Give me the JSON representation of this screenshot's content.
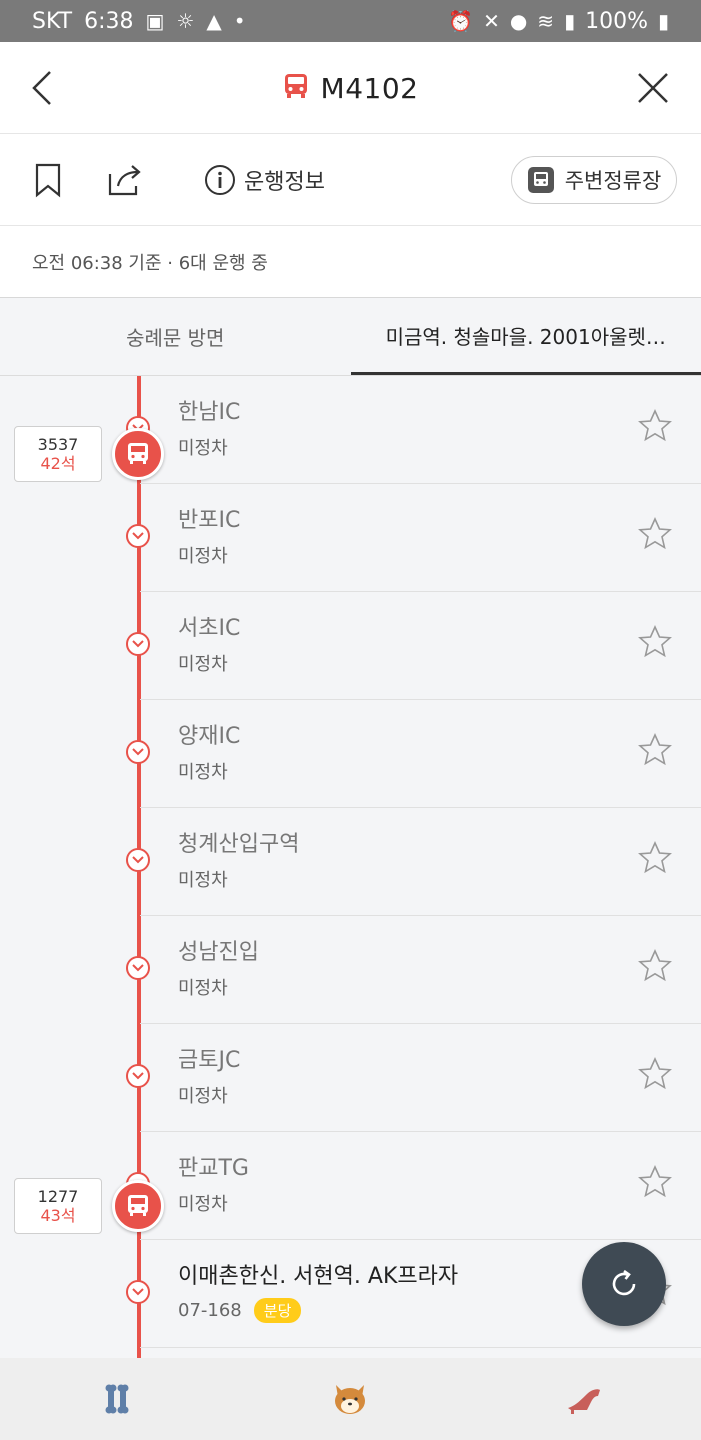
{
  "status_bar": {
    "carrier": "SKT",
    "time": "6:38",
    "battery": "100%"
  },
  "header": {
    "route_number": "M4102",
    "icons": {
      "back": "chevron-left-icon",
      "close": "close-icon",
      "bus": "bus-icon"
    }
  },
  "actions": {
    "info_label": "운행정보",
    "nearby_label": "주변정류장"
  },
  "info_line": "오전 06:38 기준 · 6대 운행 중",
  "tabs": [
    {
      "label": "숭례문 방면",
      "active": false
    },
    {
      "label": "미금역. 청솔마을. 2001아울렛…",
      "active": true
    }
  ],
  "stops": [
    {
      "name": "한남IC",
      "sub": "미정차"
    },
    {
      "name": "반포IC",
      "sub": "미정차"
    },
    {
      "name": "서초IC",
      "sub": "미정차"
    },
    {
      "name": "양재IC",
      "sub": "미정차"
    },
    {
      "name": "청계산입구역",
      "sub": "미정차"
    },
    {
      "name": "성남진입",
      "sub": "미정차"
    },
    {
      "name": "금토JC",
      "sub": "미정차"
    },
    {
      "name": "판교TG",
      "sub": "미정차"
    },
    {
      "name": "이매촌한신. 서현역. AK프라자",
      "sub": "07-168",
      "badge": "분당"
    }
  ],
  "buses": [
    {
      "number": "3537",
      "seats": "42석"
    },
    {
      "number": "1277",
      "seats": "43석"
    }
  ],
  "colors": {
    "accent": "#e8524a",
    "fab": "#3f4a54",
    "badge": "#ffcc1a"
  }
}
